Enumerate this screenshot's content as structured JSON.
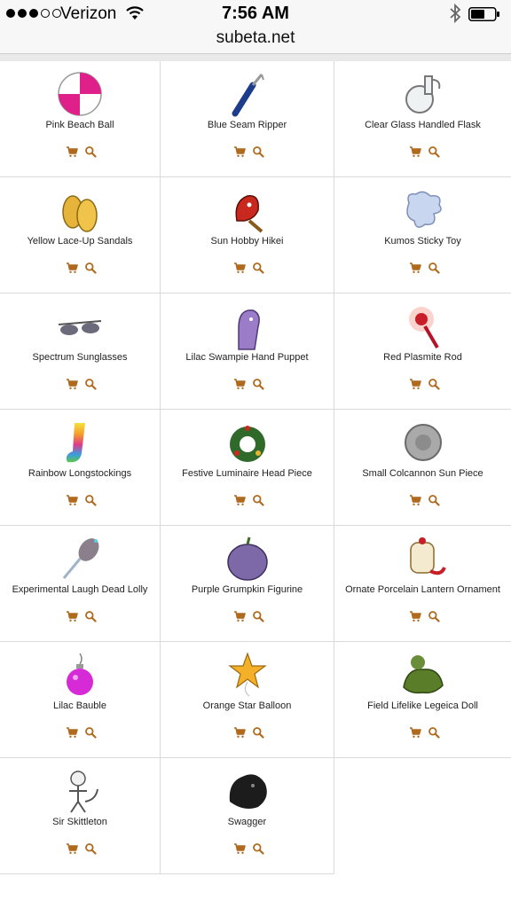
{
  "status_bar": {
    "carrier": "Verizon",
    "time": "7:56 AM"
  },
  "address_bar": {
    "domain": "subeta.net"
  },
  "items": [
    {
      "name": "Pink Beach Ball",
      "icon": "pink-beach-ball-icon"
    },
    {
      "name": "Blue Seam Ripper",
      "icon": "seam-ripper-icon"
    },
    {
      "name": "Clear Glass Handled Flask",
      "icon": "glass-flask-icon"
    },
    {
      "name": "Yellow Lace-Up Sandals",
      "icon": "sandals-icon"
    },
    {
      "name": "Sun Hobby Hikei",
      "icon": "hobby-horse-icon"
    },
    {
      "name": "Kumos Sticky Toy",
      "icon": "sticky-toy-icon"
    },
    {
      "name": "Spectrum Sunglasses",
      "icon": "sunglasses-icon"
    },
    {
      "name": "Lilac Swampie Hand Puppet",
      "icon": "hand-puppet-icon"
    },
    {
      "name": "Red Plasmite Rod",
      "icon": "plasmite-rod-icon"
    },
    {
      "name": "Rainbow Longstockings",
      "icon": "longstockings-icon"
    },
    {
      "name": "Festive Luminaire Head Piece",
      "icon": "festive-wreath-icon"
    },
    {
      "name": "Small Colcannon Sun Piece",
      "icon": "sun-piece-icon"
    },
    {
      "name": "Experimental Laugh Dead Lolly",
      "icon": "lolly-icon"
    },
    {
      "name": "Purple Grumpkin Figurine",
      "icon": "grumpkin-icon"
    },
    {
      "name": "Ornate Porcelain Lantern Ornament",
      "icon": "lantern-ornament-icon"
    },
    {
      "name": "Lilac Bauble",
      "icon": "bauble-icon"
    },
    {
      "name": "Orange Star Balloon",
      "icon": "star-balloon-icon"
    },
    {
      "name": "Field Lifelike Legeica Doll",
      "icon": "legeica-doll-icon"
    },
    {
      "name": "Sir Skittleton",
      "icon": "skeleton-cat-icon"
    },
    {
      "name": "Swagger",
      "icon": "swagger-icon"
    }
  ],
  "colors": {
    "action_icon": "#b06a1e",
    "grid_border": "#d9d9d9"
  }
}
